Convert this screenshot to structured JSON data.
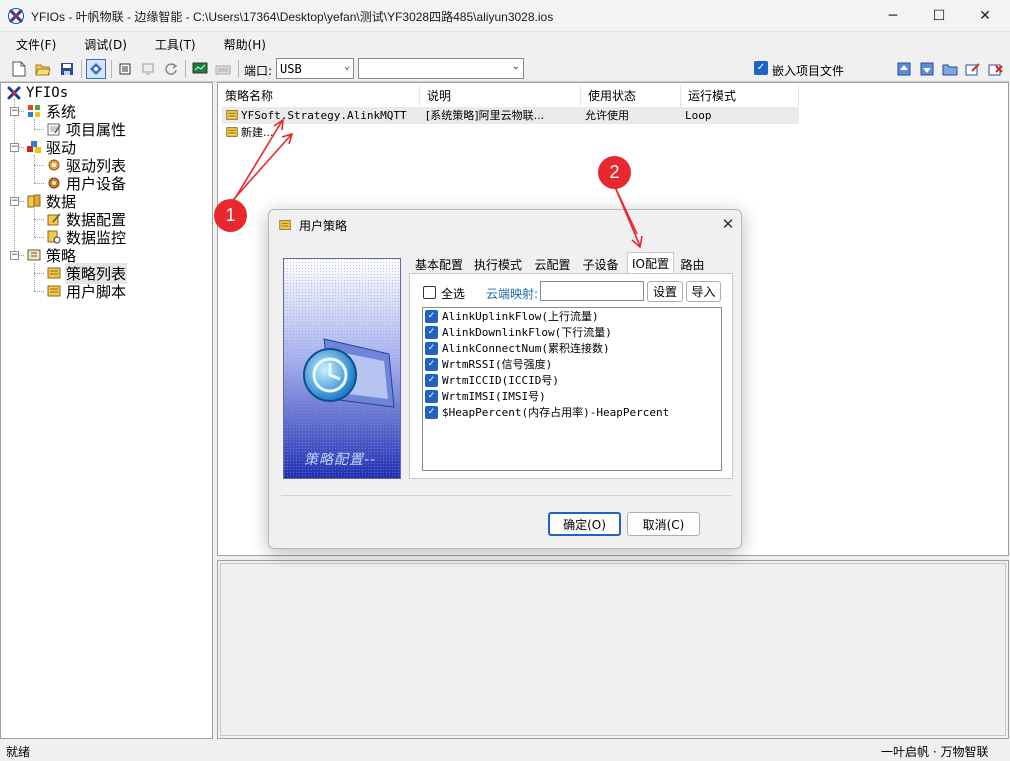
{
  "window": {
    "title": "YFIOs - 叶帆物联 - 边缘智能 - C:\\Users\\17364\\Desktop\\yefan\\测试\\YF3028四路485\\aliyun3028.ios",
    "minimize": "─",
    "maximize": "☐",
    "close": "✕"
  },
  "menu": [
    "文件(F)",
    "调试(D)",
    "工具(T)",
    "帮助(H)"
  ],
  "toolbar": {
    "port_label": "端口:",
    "port_value": "USB",
    "second_select_value": "",
    "embed_label": "嵌入项目文件",
    "embed_checked": true
  },
  "tree": {
    "root": "YFIOs",
    "groups": [
      {
        "label": "系统",
        "children": [
          "项目属性"
        ]
      },
      {
        "label": "驱动",
        "children": [
          "驱动列表",
          "用户设备"
        ]
      },
      {
        "label": "数据",
        "children": [
          "数据配置",
          "数据监控"
        ]
      },
      {
        "label": "策略",
        "children": [
          "策略列表",
          "用户脚本"
        ]
      }
    ],
    "selected": "策略列表"
  },
  "list": {
    "columns": [
      "策略名称",
      "说明",
      "使用状态",
      "运行模式"
    ],
    "rows": [
      {
        "name": "YFSoft.Strategy.AlinkMQTT",
        "desc": "[系统策略]阿里云物联...",
        "status": "允许使用",
        "mode": "Loop"
      },
      {
        "name": "新建...",
        "desc": "",
        "status": "",
        "mode": ""
      }
    ]
  },
  "status": {
    "left": "就绪",
    "right": "一叶启帆 · 万物智联"
  },
  "dialog": {
    "title": "用户策略",
    "side_caption": "策略配置--",
    "tabs": [
      "基本配置",
      "执行模式",
      "云配置",
      "子设备",
      "IO配置",
      "路由"
    ],
    "active_tab": "IO配置",
    "select_all_label": "全选",
    "select_all_checked": false,
    "cloud_map_label": "云端映射:",
    "cloud_map_value": "",
    "set_button": "设置",
    "import_button": "导入",
    "io_items": [
      "AlinkUplinkFlow(上行流量)",
      "AlinkDownlinkFlow(下行流量)",
      "AlinkConnectNum(累积连接数)",
      "WrtmRSSI(信号强度)",
      "WrtmICCID(ICCID号)",
      "WrtmIMSI(IMSI号)",
      "$HeapPercent(内存占用率)-HeapPercent"
    ],
    "ok_button": "确定(O)",
    "cancel_button": "取消(C)"
  },
  "annotations": {
    "one": "1",
    "two": "2"
  },
  "colors": {
    "accent": "#1f63c4",
    "annotation": "#e8282e",
    "link_text": "#1a6aa8"
  }
}
